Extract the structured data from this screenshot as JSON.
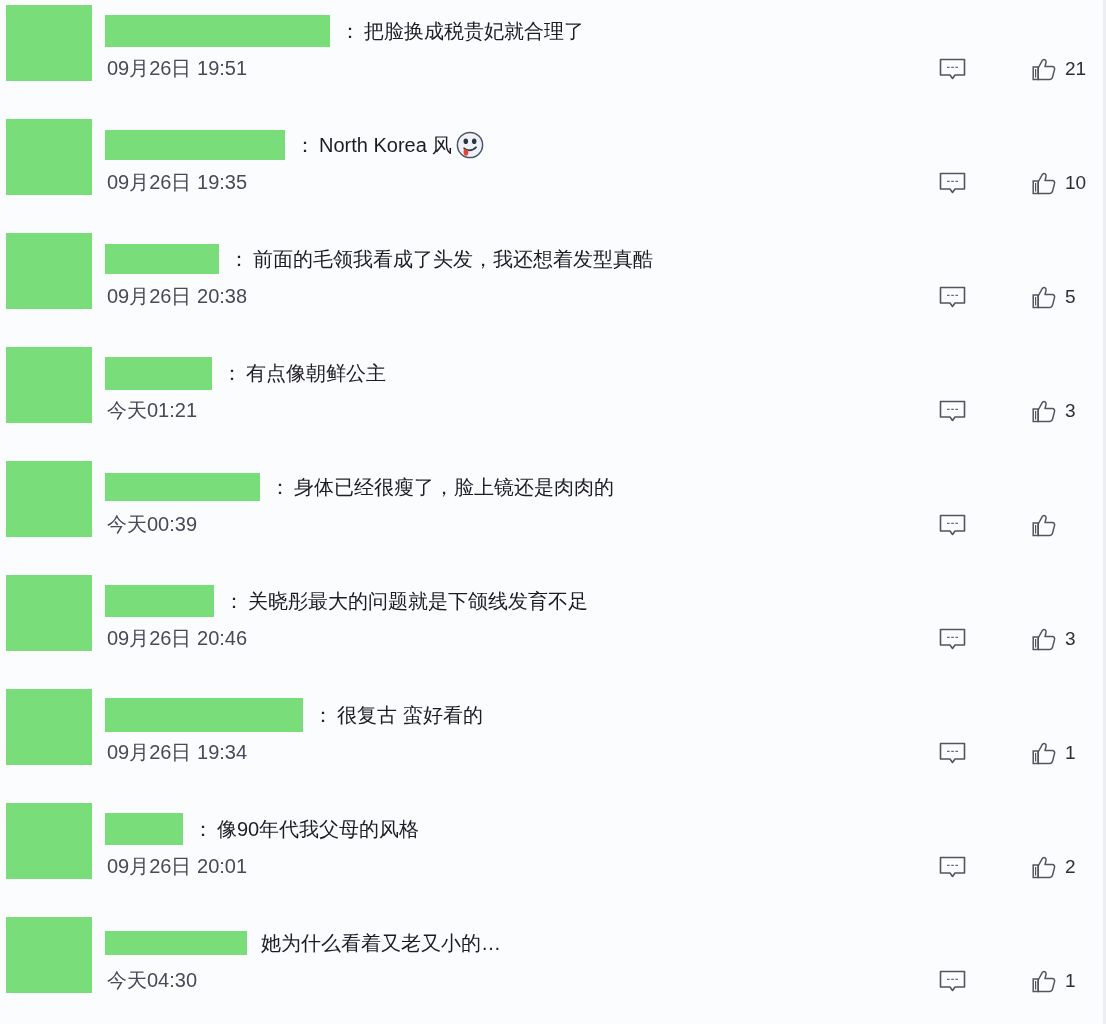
{
  "comments": [
    {
      "separator": "：",
      "text": "把脸换成税贵妃就合理了",
      "time": "09月26日 19:51",
      "likes": "21"
    },
    {
      "separator": "：",
      "text": "North Korea 风",
      "emoji": true,
      "time": "09月26日 19:35",
      "likes": "10"
    },
    {
      "separator": "：",
      "text": "前面的毛领我看成了头发，我还想着发型真酷",
      "time": "09月26日 20:38",
      "likes": "5"
    },
    {
      "separator": "：",
      "text": "有点像朝鲜公主",
      "time": "今天01:21",
      "likes": "3"
    },
    {
      "separator": "：",
      "text": "身体已经很瘦了，脸上镜还是肉肉的",
      "time": "今天00:39"
    },
    {
      "separator": "：",
      "text": "关晓彤最大的问题就是下颌线发育不足",
      "time": "09月26日 20:46",
      "likes": "3"
    },
    {
      "separator": "：",
      "text": "很复古 蛮好看的",
      "time": "09月26日 19:34",
      "likes": "1"
    },
    {
      "separator": "：",
      "text": "像90年代我父母的风格",
      "time": "09月26日 20:01",
      "likes": "2"
    },
    {
      "text": "她为什么看着又老又小的…",
      "time": "今天04:30",
      "likes": "1"
    }
  ]
}
